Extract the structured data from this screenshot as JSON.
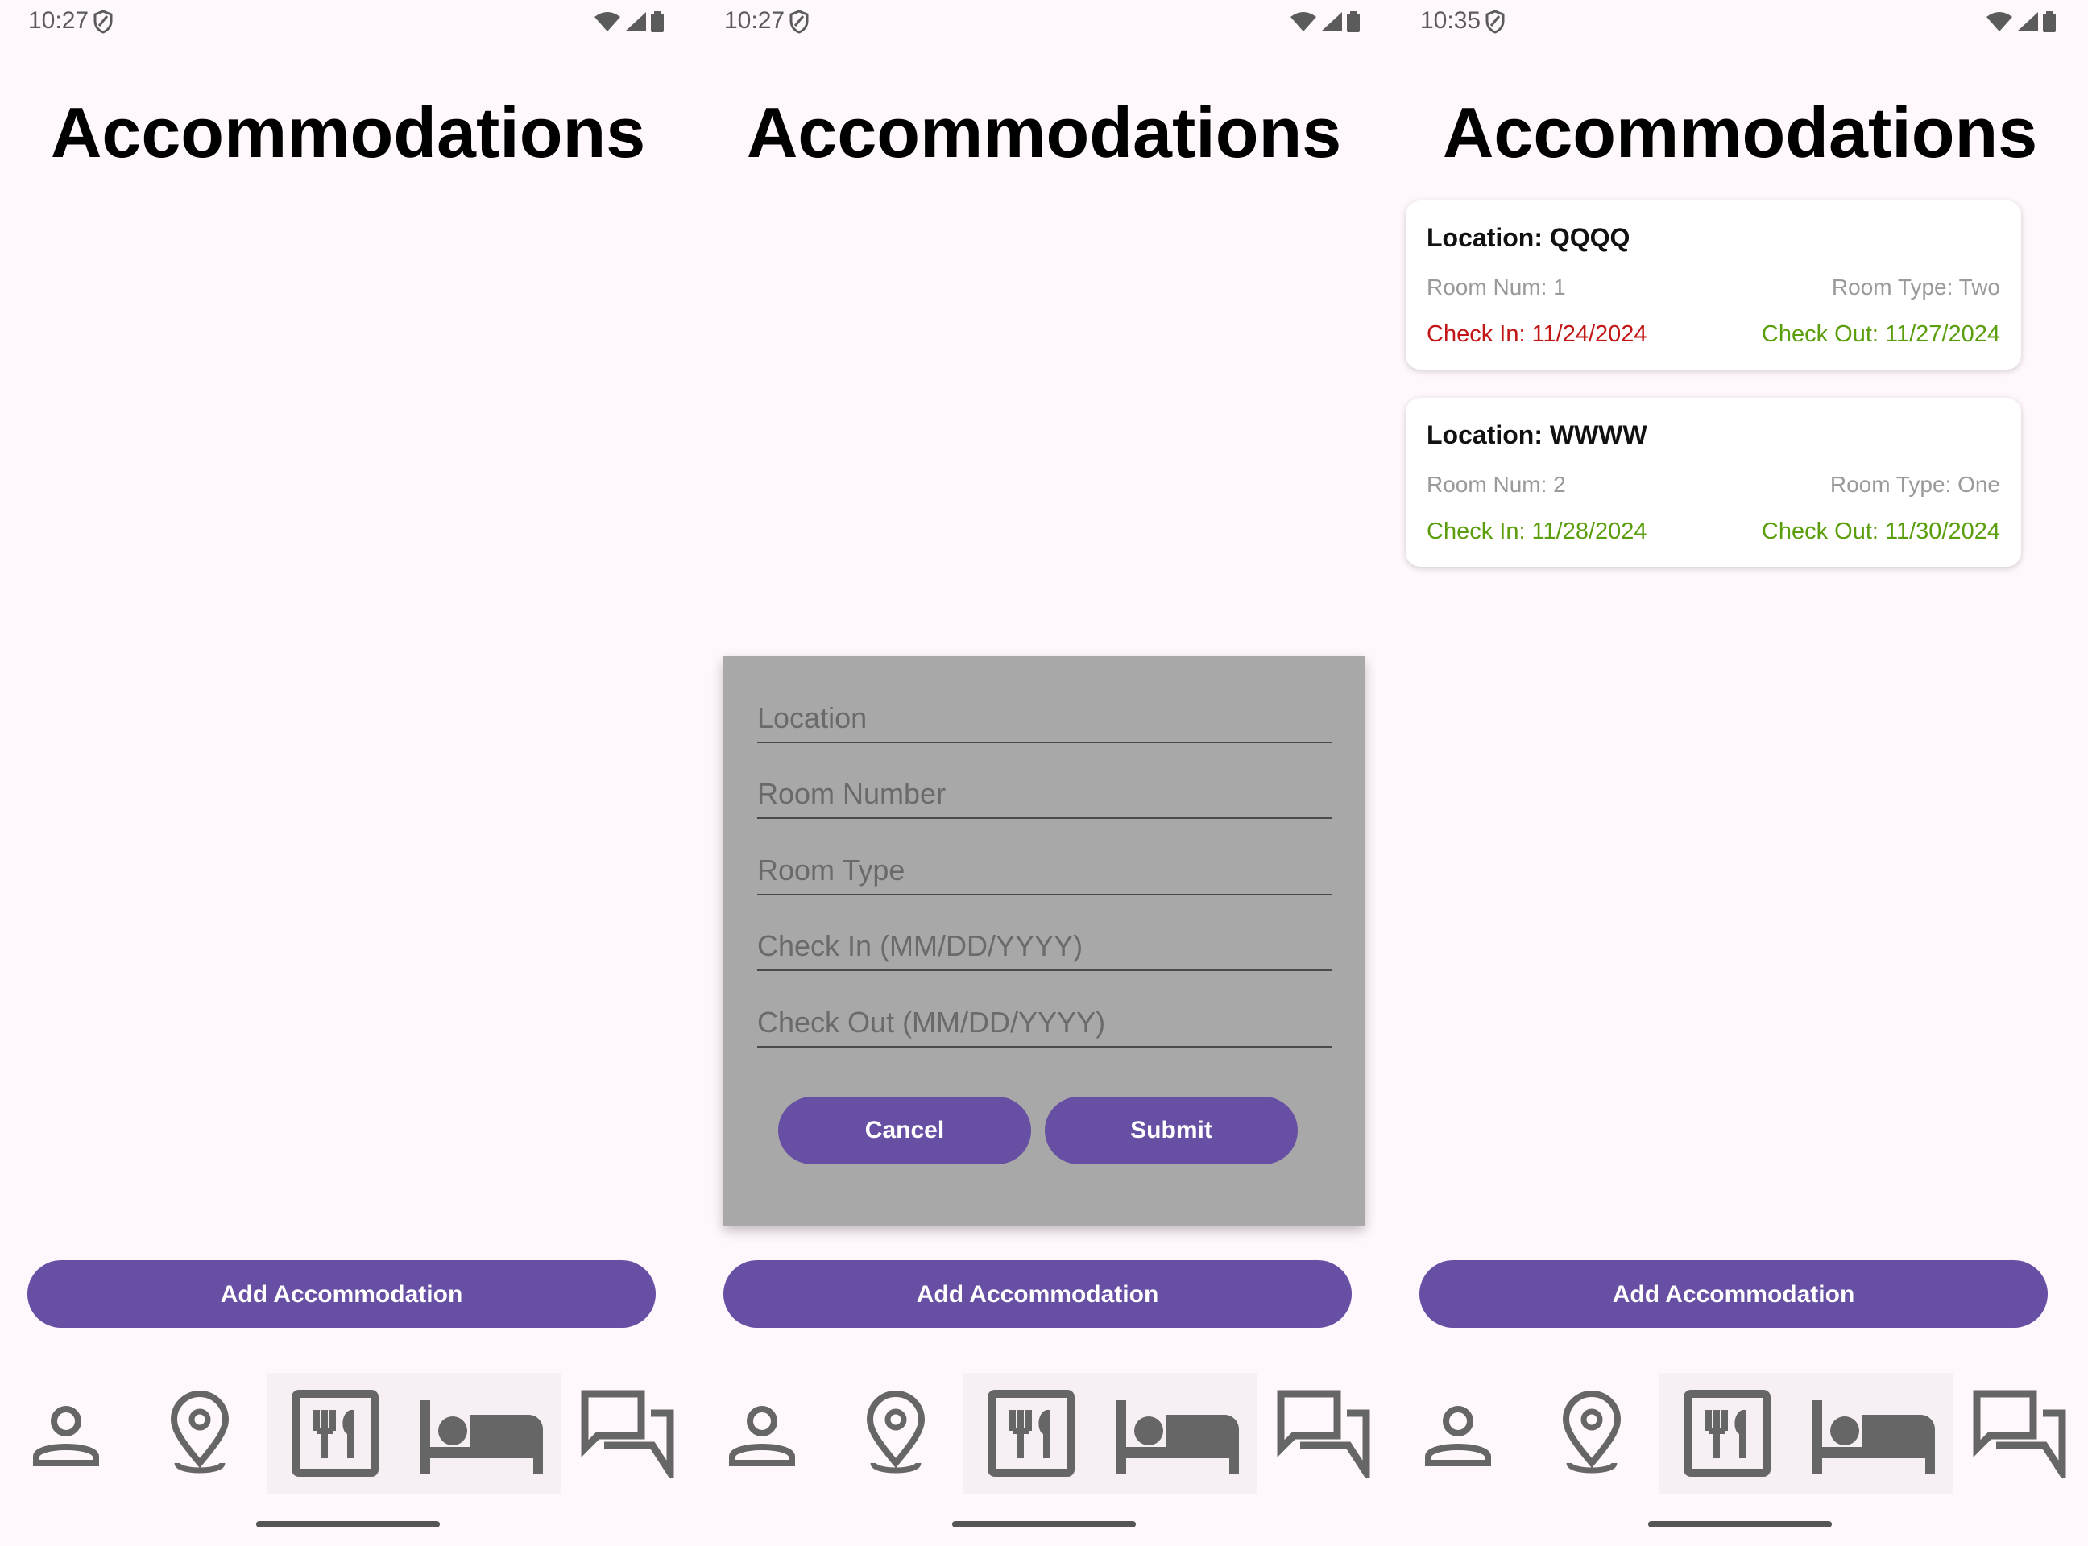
{
  "colors": {
    "background": "#fef7fc",
    "accent": "#674fa3",
    "past_date": "#c21515",
    "future_date": "#5b9e0c",
    "muted_text": "#9a9a9a",
    "dialog_bg": "#a8a8a8"
  },
  "screens": [
    {
      "status": {
        "time": "10:27"
      },
      "title": "Accommodations",
      "add_button": "Add Accommodation"
    },
    {
      "status": {
        "time": "10:27"
      },
      "title": "Accommodations",
      "add_button": "Add Accommodation",
      "dialog": {
        "fields": [
          {
            "placeholder": "Location"
          },
          {
            "placeholder": "Room Number"
          },
          {
            "placeholder": "Room Type"
          },
          {
            "placeholder": "Check In (MM/DD/YYYY)"
          },
          {
            "placeholder": "Check Out (MM/DD/YYYY)"
          }
        ],
        "cancel": "Cancel",
        "submit": "Submit"
      }
    },
    {
      "status": {
        "time": "10:35"
      },
      "title": "Accommodations",
      "add_button": "Add Accommodation",
      "cards": [
        {
          "location": "Location: QQQQ",
          "room_num": "Room Num: 1",
          "room_type": "Room Type: Two",
          "check_in": "Check In: 11/24/2024",
          "check_out": "Check Out: 11/27/2024",
          "check_in_color": "#c21515",
          "check_out_color": "#5b9e0c"
        },
        {
          "location": "Location: WWWW",
          "room_num": "Room Num: 2",
          "room_type": "Room Type: One",
          "check_in": "Check In: 11/28/2024",
          "check_out": "Check Out: 11/30/2024",
          "check_in_color": "#5b9e0c",
          "check_out_color": "#5b9e0c"
        }
      ]
    }
  ],
  "nav_icons": [
    "person-icon",
    "location-pin-icon",
    "restaurant-icon",
    "bed-icon",
    "chat-icon"
  ]
}
